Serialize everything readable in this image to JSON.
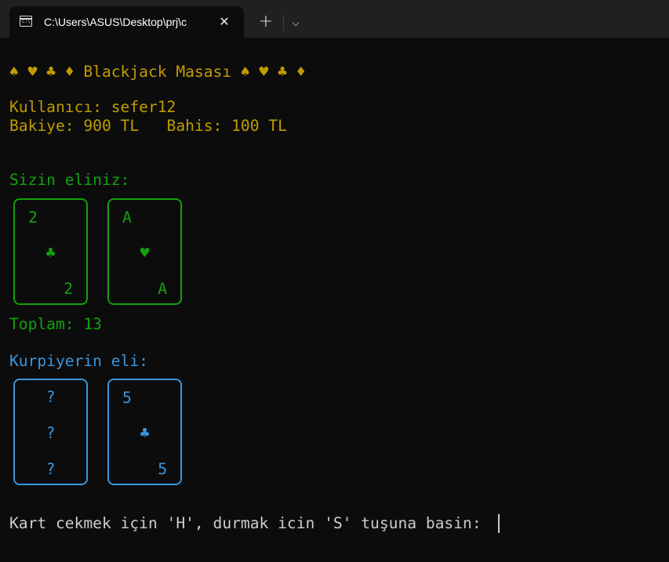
{
  "window": {
    "tab_title": "C:\\Users\\ASUS\\Desktop\\prj\\c",
    "tab_icon": "terminal-icon",
    "close_glyph": "✕",
    "new_tab_glyph": "+",
    "dropdown_glyph": "⌵"
  },
  "terminal": {
    "header": "♠ ♥ ♣ ♦ Blackjack Masası ♠ ♥ ♣ ♦",
    "user_line": "Kullanıcı: sefer12",
    "balance_line": "Bakiye: 900 TL   Bahis: 100 TL",
    "player_label": "Sizin eliniz:",
    "player_cards": [
      {
        "rank": "2",
        "suit": "♣"
      },
      {
        "rank": "A",
        "suit": "♥"
      }
    ],
    "player_total": "Toplam: 13",
    "dealer_label": "Kurpiyerin eli:",
    "dealer_cards": [
      {
        "rank": "?",
        "suit": "?"
      },
      {
        "rank": "5",
        "suit": "♣"
      }
    ],
    "prompt": "Kart cekmek için 'H', durmak icin 'S' tuşuna basin: "
  },
  "colors": {
    "background": "#0c0c0c",
    "gold": "#c19c00",
    "green": "#13a10e",
    "blue": "#3a96dd",
    "text": "#cccccc"
  }
}
